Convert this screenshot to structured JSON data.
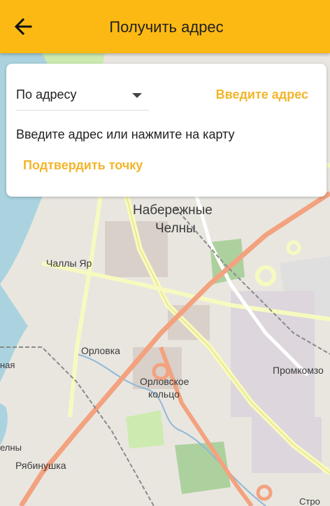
{
  "appbar": {
    "title": "Получить адрес",
    "back_icon": "arrow-left-icon"
  },
  "card": {
    "mode_select": {
      "value": "По адресу"
    },
    "enter_address_link": "Введите адрес",
    "hint": "Введите адрес или нажмите на карту",
    "confirm_link": "Подтвердить точку"
  },
  "map": {
    "labels": {
      "city_line1": "Набережные",
      "city_line2": "Челны",
      "challi_yar": "Чаллы Яр",
      "orlovka": "Орловка",
      "orlovskoe_line1": "Орловское",
      "orlovskoe_line2": "кольцо",
      "promkomzona": "Промкомзо",
      "nayа_left": "ная",
      "chelny_left": "елны",
      "ryabinushka": "Рябинушка",
      "stro": "Стро"
    }
  },
  "colors": {
    "appbar": "#fdb913",
    "accent_link": "#f2b52a",
    "water": "#aad3df",
    "map_land": "#e9e6e0"
  }
}
